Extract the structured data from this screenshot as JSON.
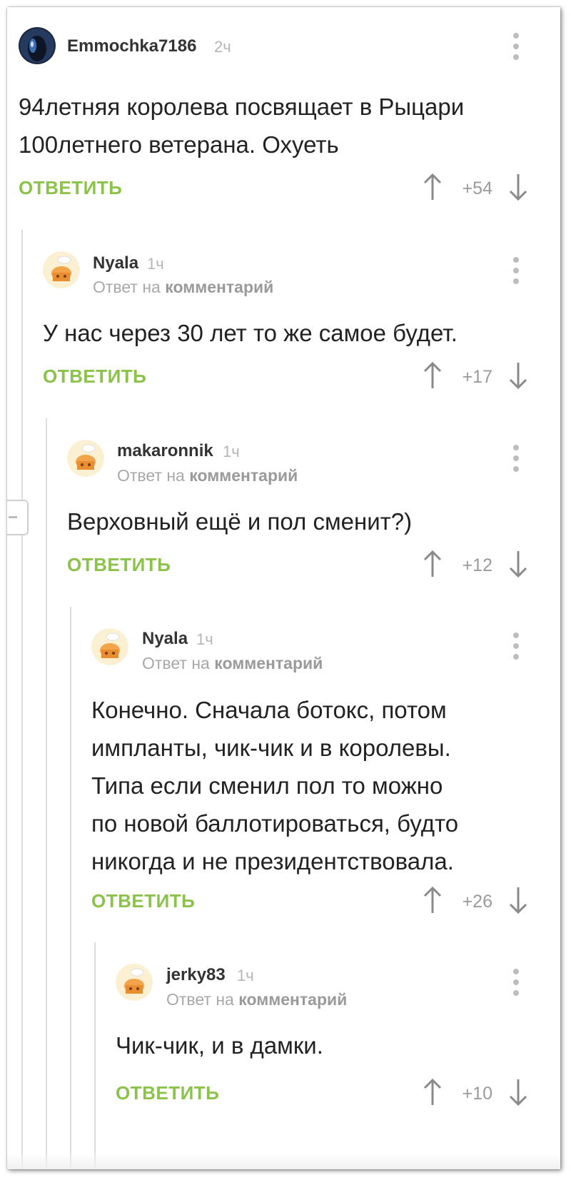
{
  "comments": [
    {
      "username": "Emmochka7186",
      "time": "2ч",
      "reply_prefix": "",
      "reply_link": "",
      "body": [
        "94летняя королева посвящает в Рыцари",
        "100летнего ветерана. Охуеть"
      ],
      "reply_label": "ОТВЕТИТЬ",
      "score": "+54",
      "avatar": "dark-blue-avatar-icon"
    },
    {
      "username": "Nyala",
      "time": "1ч",
      "reply_prefix": "Ответ на",
      "reply_link": "комментарий",
      "body": [
        "У нас через 30 лет то же самое будет."
      ],
      "reply_label": "ОТВЕТИТЬ",
      "score": "+17",
      "avatar": "default-chef-avatar-icon"
    },
    {
      "username": "makaronnik",
      "time": "1ч",
      "reply_prefix": "Ответ на",
      "reply_link": "комментарий",
      "body": [
        "Верховный ещё и пол сменит?)"
      ],
      "reply_label": "ОТВЕТИТЬ",
      "score": "+12",
      "avatar": "default-chef-avatar-icon"
    },
    {
      "username": "Nyala",
      "time": "1ч",
      "reply_prefix": "Ответ на",
      "reply_link": "комментарий",
      "body": [
        "Конечно. Сначала ботокс, потом",
        "импланты, чик-чик и в королевы.",
        "Типа если сменил пол то можно",
        "по новой баллотироваться, будто",
        "никогда и не президентствовала."
      ],
      "reply_label": "ОТВЕТИТЬ",
      "score": "+26",
      "avatar": "default-chef-avatar-icon"
    },
    {
      "username": "jerky83",
      "time": "1ч",
      "reply_prefix": "Ответ на",
      "reply_link": "комментарий",
      "body": [
        "Чик-чик, и в дамки."
      ],
      "reply_label": "ОТВЕТИТЬ",
      "score": "+10",
      "avatar": "default-chef-avatar-icon"
    }
  ],
  "colors": {
    "reply_green": "#8bc34a",
    "username": "#333333",
    "muted": "#a8a8a8"
  }
}
